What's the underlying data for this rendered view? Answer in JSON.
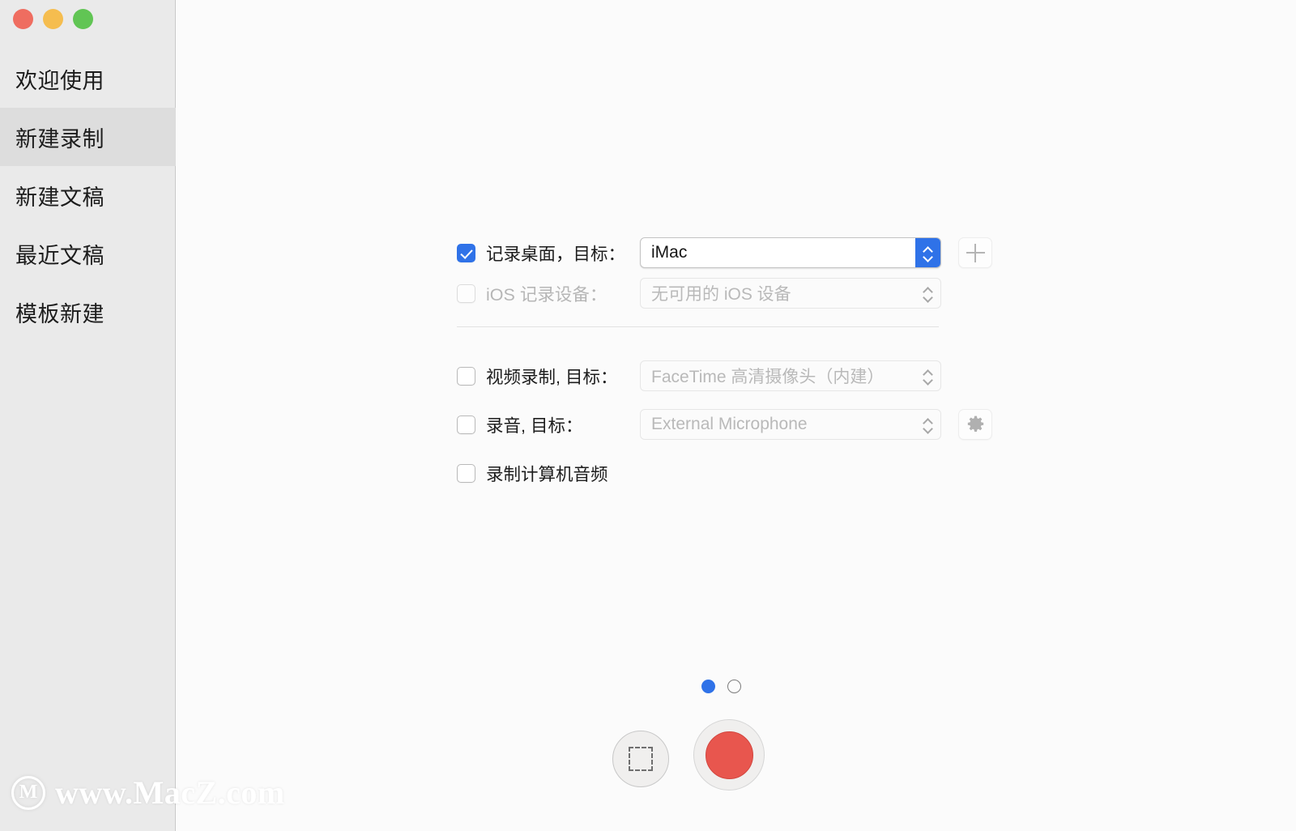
{
  "window": {
    "traffic_lights": [
      {
        "name": "close",
        "color": "#ef6d60"
      },
      {
        "name": "minimize",
        "color": "#f5bd4f"
      },
      {
        "name": "zoom",
        "color": "#61c554"
      }
    ]
  },
  "sidebar": {
    "items": [
      {
        "label": "欢迎使用",
        "selected": false
      },
      {
        "label": "新建录制",
        "selected": true
      },
      {
        "label": "新建文稿",
        "selected": false
      },
      {
        "label": "最近文稿",
        "selected": false
      },
      {
        "label": "模板新建",
        "selected": false
      }
    ]
  },
  "form": {
    "rows": [
      {
        "id": "record-desktop",
        "label": "记录桌面，目标：",
        "checked": true,
        "enabled": true,
        "select_value": "iMac",
        "select_enabled": true,
        "trailing_icon": "plus-icon"
      },
      {
        "id": "ios-device",
        "label": "iOS 记录设备：",
        "checked": false,
        "enabled": false,
        "select_value": "无可用的 iOS 设备",
        "select_enabled": false,
        "trailing_icon": null
      },
      {
        "id": "video-record",
        "label": "视频录制, 目标：",
        "checked": false,
        "enabled": true,
        "select_value": "FaceTime 高清摄像头（内建）",
        "select_enabled": false,
        "trailing_icon": null
      },
      {
        "id": "audio-record",
        "label": "录音, 目标：",
        "checked": false,
        "enabled": true,
        "select_value": "External Microphone",
        "select_enabled": false,
        "trailing_icon": "gear-icon"
      },
      {
        "id": "record-computer-audio",
        "label": "录制计算机音频",
        "checked": false,
        "enabled": true,
        "select_value": null,
        "select_enabled": false,
        "trailing_icon": null
      }
    ]
  },
  "bottom": {
    "page_dots": [
      {
        "active": true
      },
      {
        "active": false
      }
    ],
    "screenshot_button_icon": "selection-marquee-icon",
    "record_button_icon": "record-dot-icon"
  },
  "watermark": {
    "logo_letter": "M",
    "text": "www.MacZ.com"
  },
  "colors": {
    "accent": "#2f72e8",
    "record": "#e8564e",
    "sidebar_bg": "#eaeaea",
    "sidebar_selected": "#dddddd",
    "main_bg": "#fbfbfb"
  }
}
